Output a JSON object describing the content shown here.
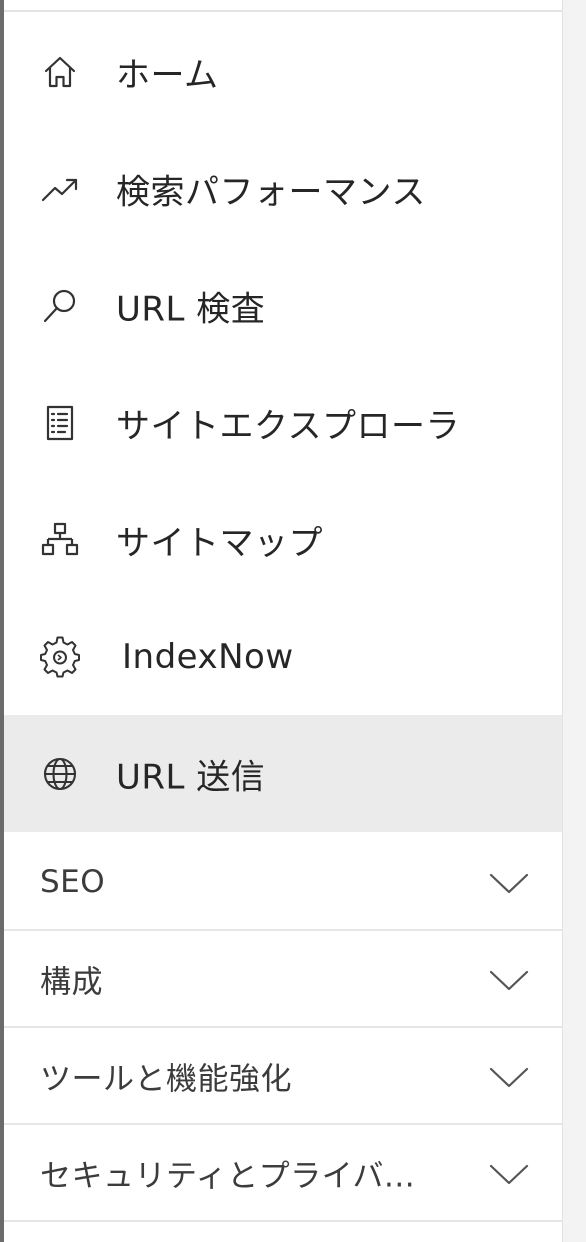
{
  "nav": {
    "items": [
      {
        "label": "ホーム",
        "icon": "home-icon"
      },
      {
        "label": "検索パフォーマンス",
        "icon": "trending-up-icon"
      },
      {
        "label": "URL 検査",
        "icon": "search-icon"
      },
      {
        "label": "サイトエクスプローラ",
        "icon": "document-list-icon"
      },
      {
        "label": "サイトマップ",
        "icon": "sitemap-icon"
      },
      {
        "label": "IndexNow",
        "icon": "gear-icon"
      },
      {
        "label": "URL 送信",
        "icon": "globe-icon",
        "selected": true
      }
    ]
  },
  "sections": [
    {
      "label": "SEO",
      "icon": "chevron-down-icon"
    },
    {
      "label": "構成",
      "icon": "chevron-down-icon"
    },
    {
      "label": "ツールと機能強化",
      "icon": "chevron-down-icon"
    },
    {
      "label": "セキュリティとプライバ...",
      "icon": "chevron-down-icon"
    }
  ],
  "colors": {
    "selected_background": "#ebebeb",
    "text": "#262626",
    "icon": "#333333",
    "divider": "#e6e6e6"
  }
}
